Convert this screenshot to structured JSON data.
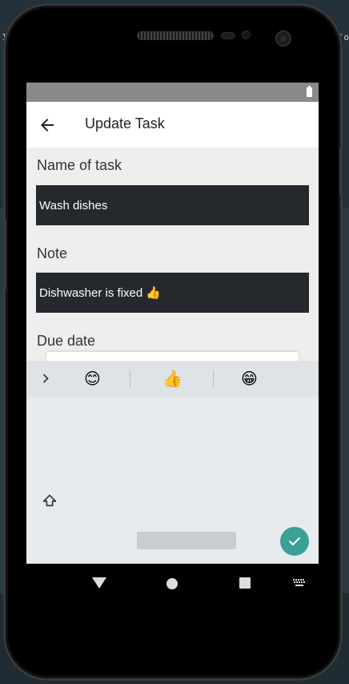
{
  "background": {
    "left_text": "1",
    "right_text": "'o"
  },
  "appbar": {
    "title": "Update Task"
  },
  "form": {
    "name_label": "Name of task",
    "name_value": "Wash dishes",
    "note_label": "Note",
    "note_value": "Dishwasher is fixed 👍",
    "due_label": "Due date"
  },
  "keyboard": {
    "suggestions": [
      "😊",
      "👍",
      "😁"
    ]
  },
  "colors": {
    "accent": "#3aa197",
    "field_bg": "#25282c",
    "statusbar": "#8a8a8a"
  },
  "icons": {
    "back": "arrow-back-icon",
    "chevron": "chevron-right-icon",
    "shift": "shift-icon",
    "done": "check-icon"
  }
}
